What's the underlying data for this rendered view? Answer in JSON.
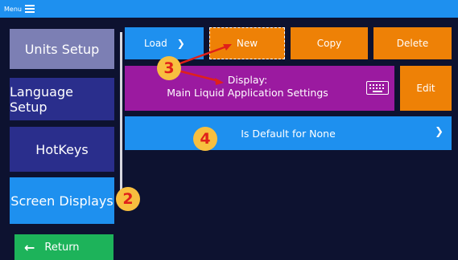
{
  "topbar": {
    "menu_label": "Menu"
  },
  "sidebar": {
    "items": [
      {
        "label": "Units Setup",
        "bg": "#7c7fb4"
      },
      {
        "label": "Language Setup",
        "bg": "#2a2e8c"
      },
      {
        "label": "HotKeys",
        "bg": "#2a2e8c"
      },
      {
        "label": "Screen Displays",
        "bg": "#1e90ef"
      }
    ],
    "return_label": "Return"
  },
  "toolbar": {
    "load_label": "Load",
    "new_label": "New",
    "copy_label": "Copy",
    "delete_label": "Delete"
  },
  "display": {
    "line1": "Display:",
    "line2": "Main Liquid Application Settings",
    "edit_label": "Edit"
  },
  "default_select": {
    "value": "Is Default for None"
  },
  "annotations": {
    "badge2": "2",
    "badge3": "3",
    "badge4": "4"
  },
  "colors": {
    "accent_blue": "#1e90ef",
    "orange": "#ee8106",
    "purple": "#9b1aa0",
    "green": "#1db35a",
    "background": "#0d1230",
    "badge": "#f8bf3f",
    "badge_text": "#e0201a"
  }
}
